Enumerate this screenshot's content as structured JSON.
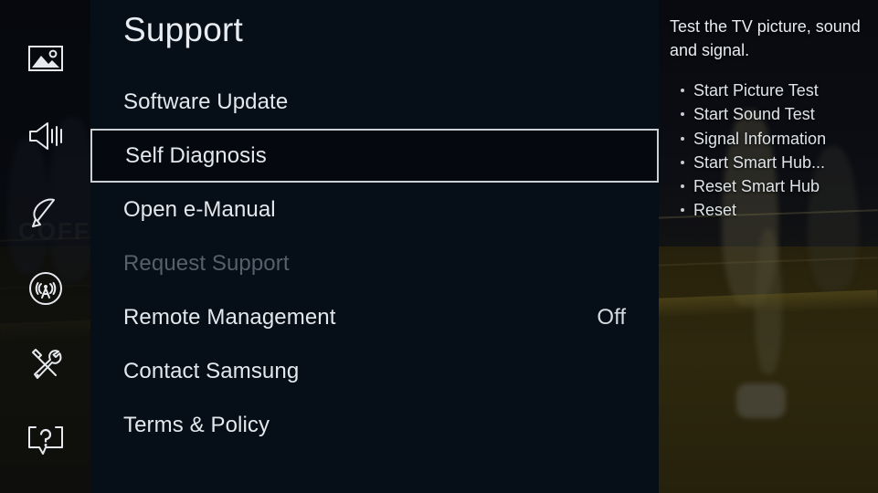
{
  "colors": {
    "panel_bg": "#060e17",
    "selected_bg": "#05090f",
    "selected_border": "#c9d0d6",
    "text_primary": "#e3e8ec",
    "text_disabled": "#55606b",
    "rail_bg": "rgba(6,8,12,0.72)"
  },
  "sidebar": {
    "items": [
      {
        "icon": "picture-icon",
        "name": "picture",
        "selected": false
      },
      {
        "icon": "sound-icon",
        "name": "sound",
        "selected": false
      },
      {
        "icon": "broadcast-icon",
        "name": "broadcast",
        "selected": false
      },
      {
        "icon": "network-icon",
        "name": "network",
        "selected": false
      },
      {
        "icon": "general-icon",
        "name": "general",
        "selected": false
      },
      {
        "icon": "support-icon",
        "name": "support",
        "selected": true
      }
    ]
  },
  "panel": {
    "title": "Support",
    "items": [
      {
        "label": "Software Update",
        "value": "",
        "state": "normal"
      },
      {
        "label": "Self Diagnosis",
        "value": "",
        "state": "selected"
      },
      {
        "label": "Open e-Manual",
        "value": "",
        "state": "normal"
      },
      {
        "label": "Request Support",
        "value": "",
        "state": "disabled"
      },
      {
        "label": "Remote Management",
        "value": "Off",
        "state": "normal"
      },
      {
        "label": "Contact Samsung",
        "value": "",
        "state": "normal"
      },
      {
        "label": "Terms & Policy",
        "value": "",
        "state": "normal"
      }
    ]
  },
  "help": {
    "description": "Test the TV picture, sound and signal.",
    "items": [
      "Start Picture Test",
      "Start Sound Test",
      "Signal Information",
      "Start Smart Hub...",
      "Reset Smart Hub",
      "Reset"
    ]
  },
  "background": {
    "sign_text": "COFFEE"
  }
}
